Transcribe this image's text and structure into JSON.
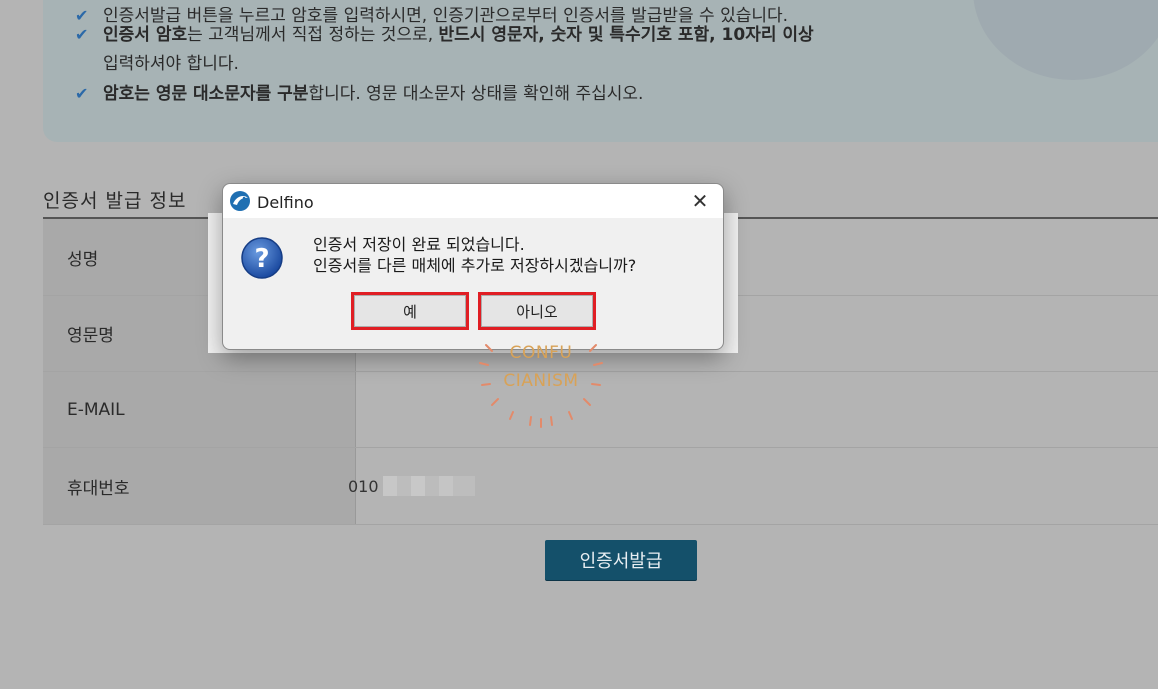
{
  "info": {
    "line1": "인증서발급 버튼을 누르고 암호를 입력하시면, 인증기관으로부터 인증서를 발급받을 수 있습니다.",
    "line2_bold1": "인증서 암호",
    "line2_mid": "는 고객님께서 직접 정하는 것으로, ",
    "line2_bold2": "반드시 영문자, 숫자 및 특수기호 포함, 10자리 이상",
    "line2_cont": "입력하셔야 합니다.",
    "line3_bold1": "암호는 영문 대소문자를 구분",
    "line3_rest": "합니다. 영문 대소문자 상태를 확인해 주십시오."
  },
  "section_title": "인증서 발급 정보",
  "rows": [
    {
      "label": "성명",
      "value": ""
    },
    {
      "label": "영문명",
      "value": ""
    },
    {
      "label": "E-MAIL",
      "value": ""
    },
    {
      "label": "휴대번호",
      "value": "010"
    }
  ],
  "issue_button": "인증서발급",
  "dialog": {
    "title": "Delfino",
    "close": "✕",
    "message_line1": "인증서 저장이 완료 되었습니다.",
    "message_line2": "인증서를 다른 매체에 추가로 저장하시겠습니까?",
    "yes": "예",
    "no": "아니오"
  },
  "watermark": {
    "line1": "CONFU",
    "line2": "CIANISM"
  }
}
